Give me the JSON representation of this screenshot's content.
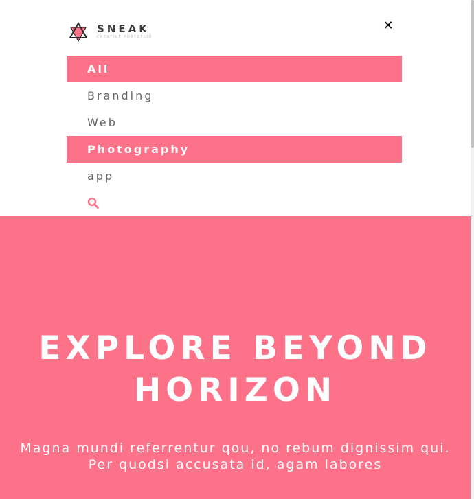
{
  "brand": {
    "name": "SNEAK",
    "tagline": "CREATIVE PORTOFLIO"
  },
  "nav": {
    "close_label": "✕",
    "items": [
      {
        "label": "All",
        "active": true
      },
      {
        "label": "Branding",
        "active": false
      },
      {
        "label": "Web",
        "active": false
      },
      {
        "label": "Photography",
        "active": true
      },
      {
        "label": "app",
        "active": false
      }
    ],
    "search_icon": "search-icon"
  },
  "hero": {
    "title": "EXPLORE BEYOND HORIZON",
    "subtitle_line1": "Magna mundi referrentur qou, no rebum dignissim qui.",
    "subtitle_line2": "Per quodsi accusata id, agam labores"
  },
  "colors": {
    "accent": "#fd7289",
    "text_dark": "#3a3a3a",
    "menu_text": "#666666",
    "white": "#ffffff"
  }
}
